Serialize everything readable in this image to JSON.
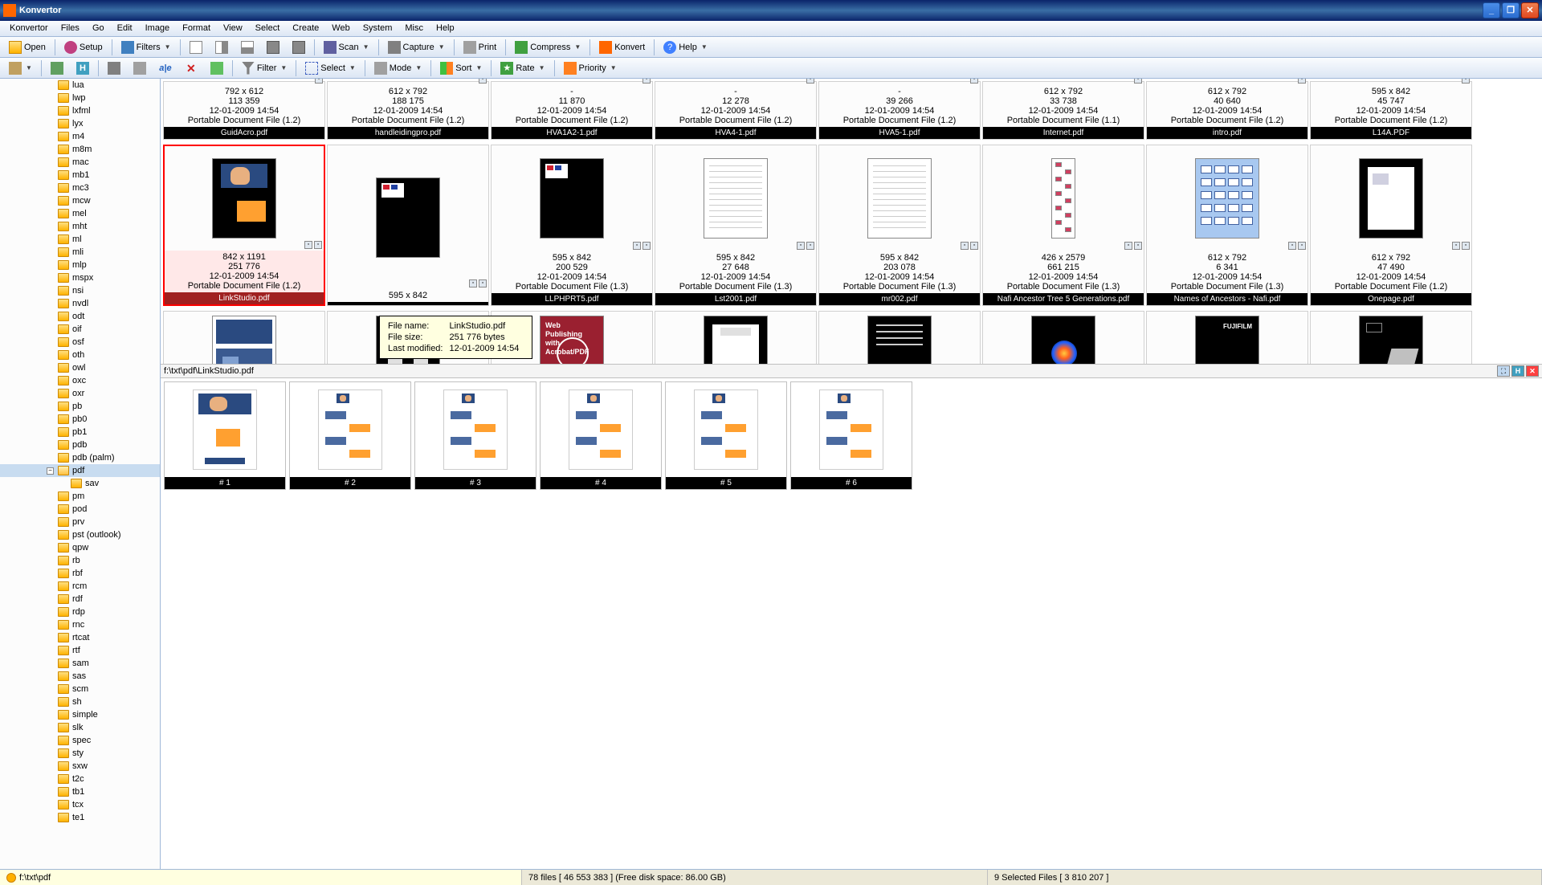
{
  "app": {
    "title": "Konvertor"
  },
  "menu": [
    "Konvertor",
    "Files",
    "Go",
    "Edit",
    "Image",
    "Format",
    "View",
    "Select",
    "Create",
    "Web",
    "System",
    "Misc",
    "Help"
  ],
  "toolbar1": {
    "open": "Open",
    "setup": "Setup",
    "filters": "Filters",
    "scan": "Scan",
    "capture": "Capture",
    "print": "Print",
    "compress": "Compress",
    "konvert": "Konvert",
    "help": "Help"
  },
  "toolbar2": {
    "filter": "Filter",
    "select": "Select",
    "mode": "Mode",
    "sort": "Sort",
    "rate": "Rate",
    "priority": "Priority"
  },
  "tree": [
    {
      "name": "lua"
    },
    {
      "name": "lwp"
    },
    {
      "name": "lxfml"
    },
    {
      "name": "lyx"
    },
    {
      "name": "m4"
    },
    {
      "name": "m8m"
    },
    {
      "name": "mac"
    },
    {
      "name": "mb1"
    },
    {
      "name": "mc3"
    },
    {
      "name": "mcw"
    },
    {
      "name": "mel"
    },
    {
      "name": "mht"
    },
    {
      "name": "ml"
    },
    {
      "name": "mli"
    },
    {
      "name": "mlp"
    },
    {
      "name": "mspx"
    },
    {
      "name": "nsi"
    },
    {
      "name": "nvdl"
    },
    {
      "name": "odt"
    },
    {
      "name": "oif"
    },
    {
      "name": "osf"
    },
    {
      "name": "oth"
    },
    {
      "name": "owl"
    },
    {
      "name": "oxc"
    },
    {
      "name": "oxr"
    },
    {
      "name": "pb"
    },
    {
      "name": "pb0"
    },
    {
      "name": "pb1"
    },
    {
      "name": "pdb"
    },
    {
      "name": "pdb (palm)"
    },
    {
      "name": "pdf",
      "selected": true,
      "open": true
    },
    {
      "name": "sav",
      "sub": true
    },
    {
      "name": "pm"
    },
    {
      "name": "pod"
    },
    {
      "name": "prv"
    },
    {
      "name": "pst (outlook)"
    },
    {
      "name": "qpw"
    },
    {
      "name": "rb"
    },
    {
      "name": "rbf"
    },
    {
      "name": "rcm"
    },
    {
      "name": "rdf"
    },
    {
      "name": "rdp"
    },
    {
      "name": "rnc"
    },
    {
      "name": "rtcat"
    },
    {
      "name": "rtf"
    },
    {
      "name": "sam"
    },
    {
      "name": "sas"
    },
    {
      "name": "scm"
    },
    {
      "name": "sh"
    },
    {
      "name": "simple"
    },
    {
      "name": "slk"
    },
    {
      "name": "spec"
    },
    {
      "name": "sty"
    },
    {
      "name": "sxw"
    },
    {
      "name": "t2c"
    },
    {
      "name": "tb1"
    },
    {
      "name": "tcx"
    },
    {
      "name": "te1"
    }
  ],
  "row1": [
    {
      "dim": "792 x 612",
      "size": "113 359",
      "date": "12-01-2009  14:54",
      "type": "Portable Document File (1.2)",
      "name": "GuidAcro.pdf"
    },
    {
      "dim": "612 x 792",
      "size": "188 175",
      "date": "12-01-2009  14:54",
      "type": "Portable Document File (1.2)",
      "name": "handleidingpro.pdf"
    },
    {
      "dim": "-",
      "size": "11 870",
      "date": "12-01-2009  14:54",
      "type": "Portable Document File (1.2)",
      "name": "HVA1A2-1.pdf"
    },
    {
      "dim": "-",
      "size": "12 278",
      "date": "12-01-2009  14:54",
      "type": "Portable Document File (1.2)",
      "name": "HVA4-1.pdf"
    },
    {
      "dim": "-",
      "size": "39 266",
      "date": "12-01-2009  14:54",
      "type": "Portable Document File (1.2)",
      "name": "HVA5-1.pdf"
    },
    {
      "dim": "612 x 792",
      "size": "33 738",
      "date": "12-01-2009  14:54",
      "type": "Portable Document File (1.1)",
      "name": "Internet.pdf"
    },
    {
      "dim": "612 x 792",
      "size": "40 640",
      "date": "12-01-2009  14:54",
      "type": "Portable Document File (1.2)",
      "name": "intro.pdf"
    },
    {
      "dim": "595 x 842",
      "size": "45 747",
      "date": "12-01-2009  14:54",
      "type": "Portable Document File (1.2)",
      "name": "L14A.PDF"
    }
  ],
  "row2": [
    {
      "dim": "842 x 1191",
      "size": "251 776",
      "date": "12-01-2009  14:54",
      "type": "Portable Document File (1.2)",
      "name": "LinkStudio.pdf",
      "selected": true,
      "bg": "dark",
      "kind": "photo"
    },
    {
      "dim": "595 x 842",
      "size": "",
      "date": "",
      "type": "",
      "name": "",
      "bg": "dark",
      "kind": "flagbox"
    },
    {
      "dim": "595 x 842",
      "size": "200 529",
      "date": "12-01-2009  14:54",
      "type": "Portable Document File (1.3)",
      "name": "LLPHPRT5.pdf",
      "bg": "dark",
      "kind": "flagbox"
    },
    {
      "dim": "595 x 842",
      "size": "27 648",
      "date": "12-01-2009  14:54",
      "type": "Portable Document File (1.3)",
      "name": "Lst2001.pdf",
      "bg": "white",
      "kind": "form"
    },
    {
      "dim": "595 x 842",
      "size": "203 078",
      "date": "12-01-2009  14:54",
      "type": "Portable Document File (1.3)",
      "name": "mr002.pdf",
      "bg": "white",
      "kind": "table"
    },
    {
      "dim": "426 x 2579",
      "size": "661 215",
      "date": "12-01-2009  14:54",
      "type": "Portable Document File (1.3)",
      "name": "Nafi Ancestor Tree 5 Generations.pdf",
      "bg": "white",
      "kind": "tree"
    },
    {
      "dim": "612 x 792",
      "size": "6 341",
      "date": "12-01-2009  14:54",
      "type": "Portable Document File (1.3)",
      "name": "Names of Ancestors - Nafi.pdf",
      "bg": "blue",
      "kind": "diagram"
    },
    {
      "dim": "612 x 792",
      "size": "47 490",
      "date": "12-01-2009  14:54",
      "type": "Portable Document File (1.2)",
      "name": "Onepage.pdf",
      "bg": "dark",
      "kind": "whitebox"
    }
  ],
  "row3": [
    {
      "bg": "white",
      "kind": "map"
    },
    {
      "bg": "dark",
      "kind": "twobox"
    },
    {
      "bg": "red",
      "kind": "webpub",
      "text": "Web Publishing\nwith Acrobat/PDF"
    },
    {
      "bg": "dark",
      "kind": "whitedoc"
    },
    {
      "bg": "dark",
      "kind": "lines"
    },
    {
      "bg": "dark",
      "kind": "orb"
    },
    {
      "bg": "dark",
      "kind": "fuji",
      "text": "FUJIFILM"
    },
    {
      "bg": "dark",
      "kind": "device"
    }
  ],
  "tooltip": {
    "fn_label": "File name:",
    "fn_val": "LinkStudio.pdf",
    "fs_label": "File size:",
    "fs_val": "251 776 bytes",
    "lm_label": "Last modified:",
    "lm_val": "12-01-2009  14:54"
  },
  "pathbar": {
    "path": "f:\\txt\\pdf\\LinkStudio.pdf"
  },
  "pages": [
    {
      "label": "# 1"
    },
    {
      "label": "# 2"
    },
    {
      "label": "# 3"
    },
    {
      "label": "# 4"
    },
    {
      "label": "# 5"
    },
    {
      "label": "# 6"
    }
  ],
  "status": {
    "path": "f:\\txt\\pdf",
    "files": "78 files [ 46 553 383 ]   (Free disk space: 86.00 GB)",
    "selected": "9 Selected Files  [ 3 810 207 ]"
  }
}
